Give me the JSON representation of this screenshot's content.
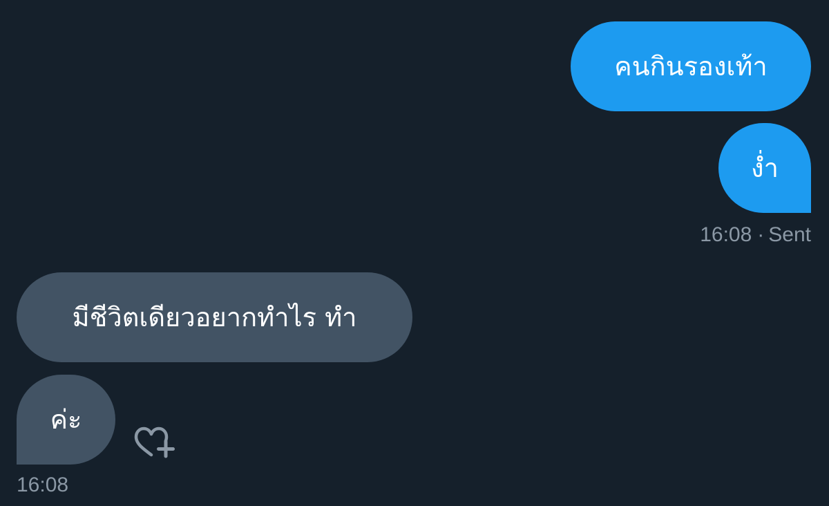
{
  "conversation": {
    "sent_messages": [
      {
        "text": "คนกินรองเท้า"
      },
      {
        "text": "ง่ำ"
      }
    ],
    "sent_meta": {
      "time": "16:08",
      "separator": "·",
      "status": "Sent"
    },
    "received_messages": [
      {
        "text": "มีชีวิตเดียวอยากทำไร ทำ"
      },
      {
        "text": "ค่ะ"
      }
    ],
    "received_meta": {
      "time": "16:08"
    },
    "reaction": {
      "icon": "heart-plus-icon"
    }
  },
  "colors": {
    "background": "#15202b",
    "sent_bubble": "#1d9bf0",
    "received_bubble": "#425364",
    "meta_text": "#8b98a5",
    "icon": "#8b98a5"
  }
}
